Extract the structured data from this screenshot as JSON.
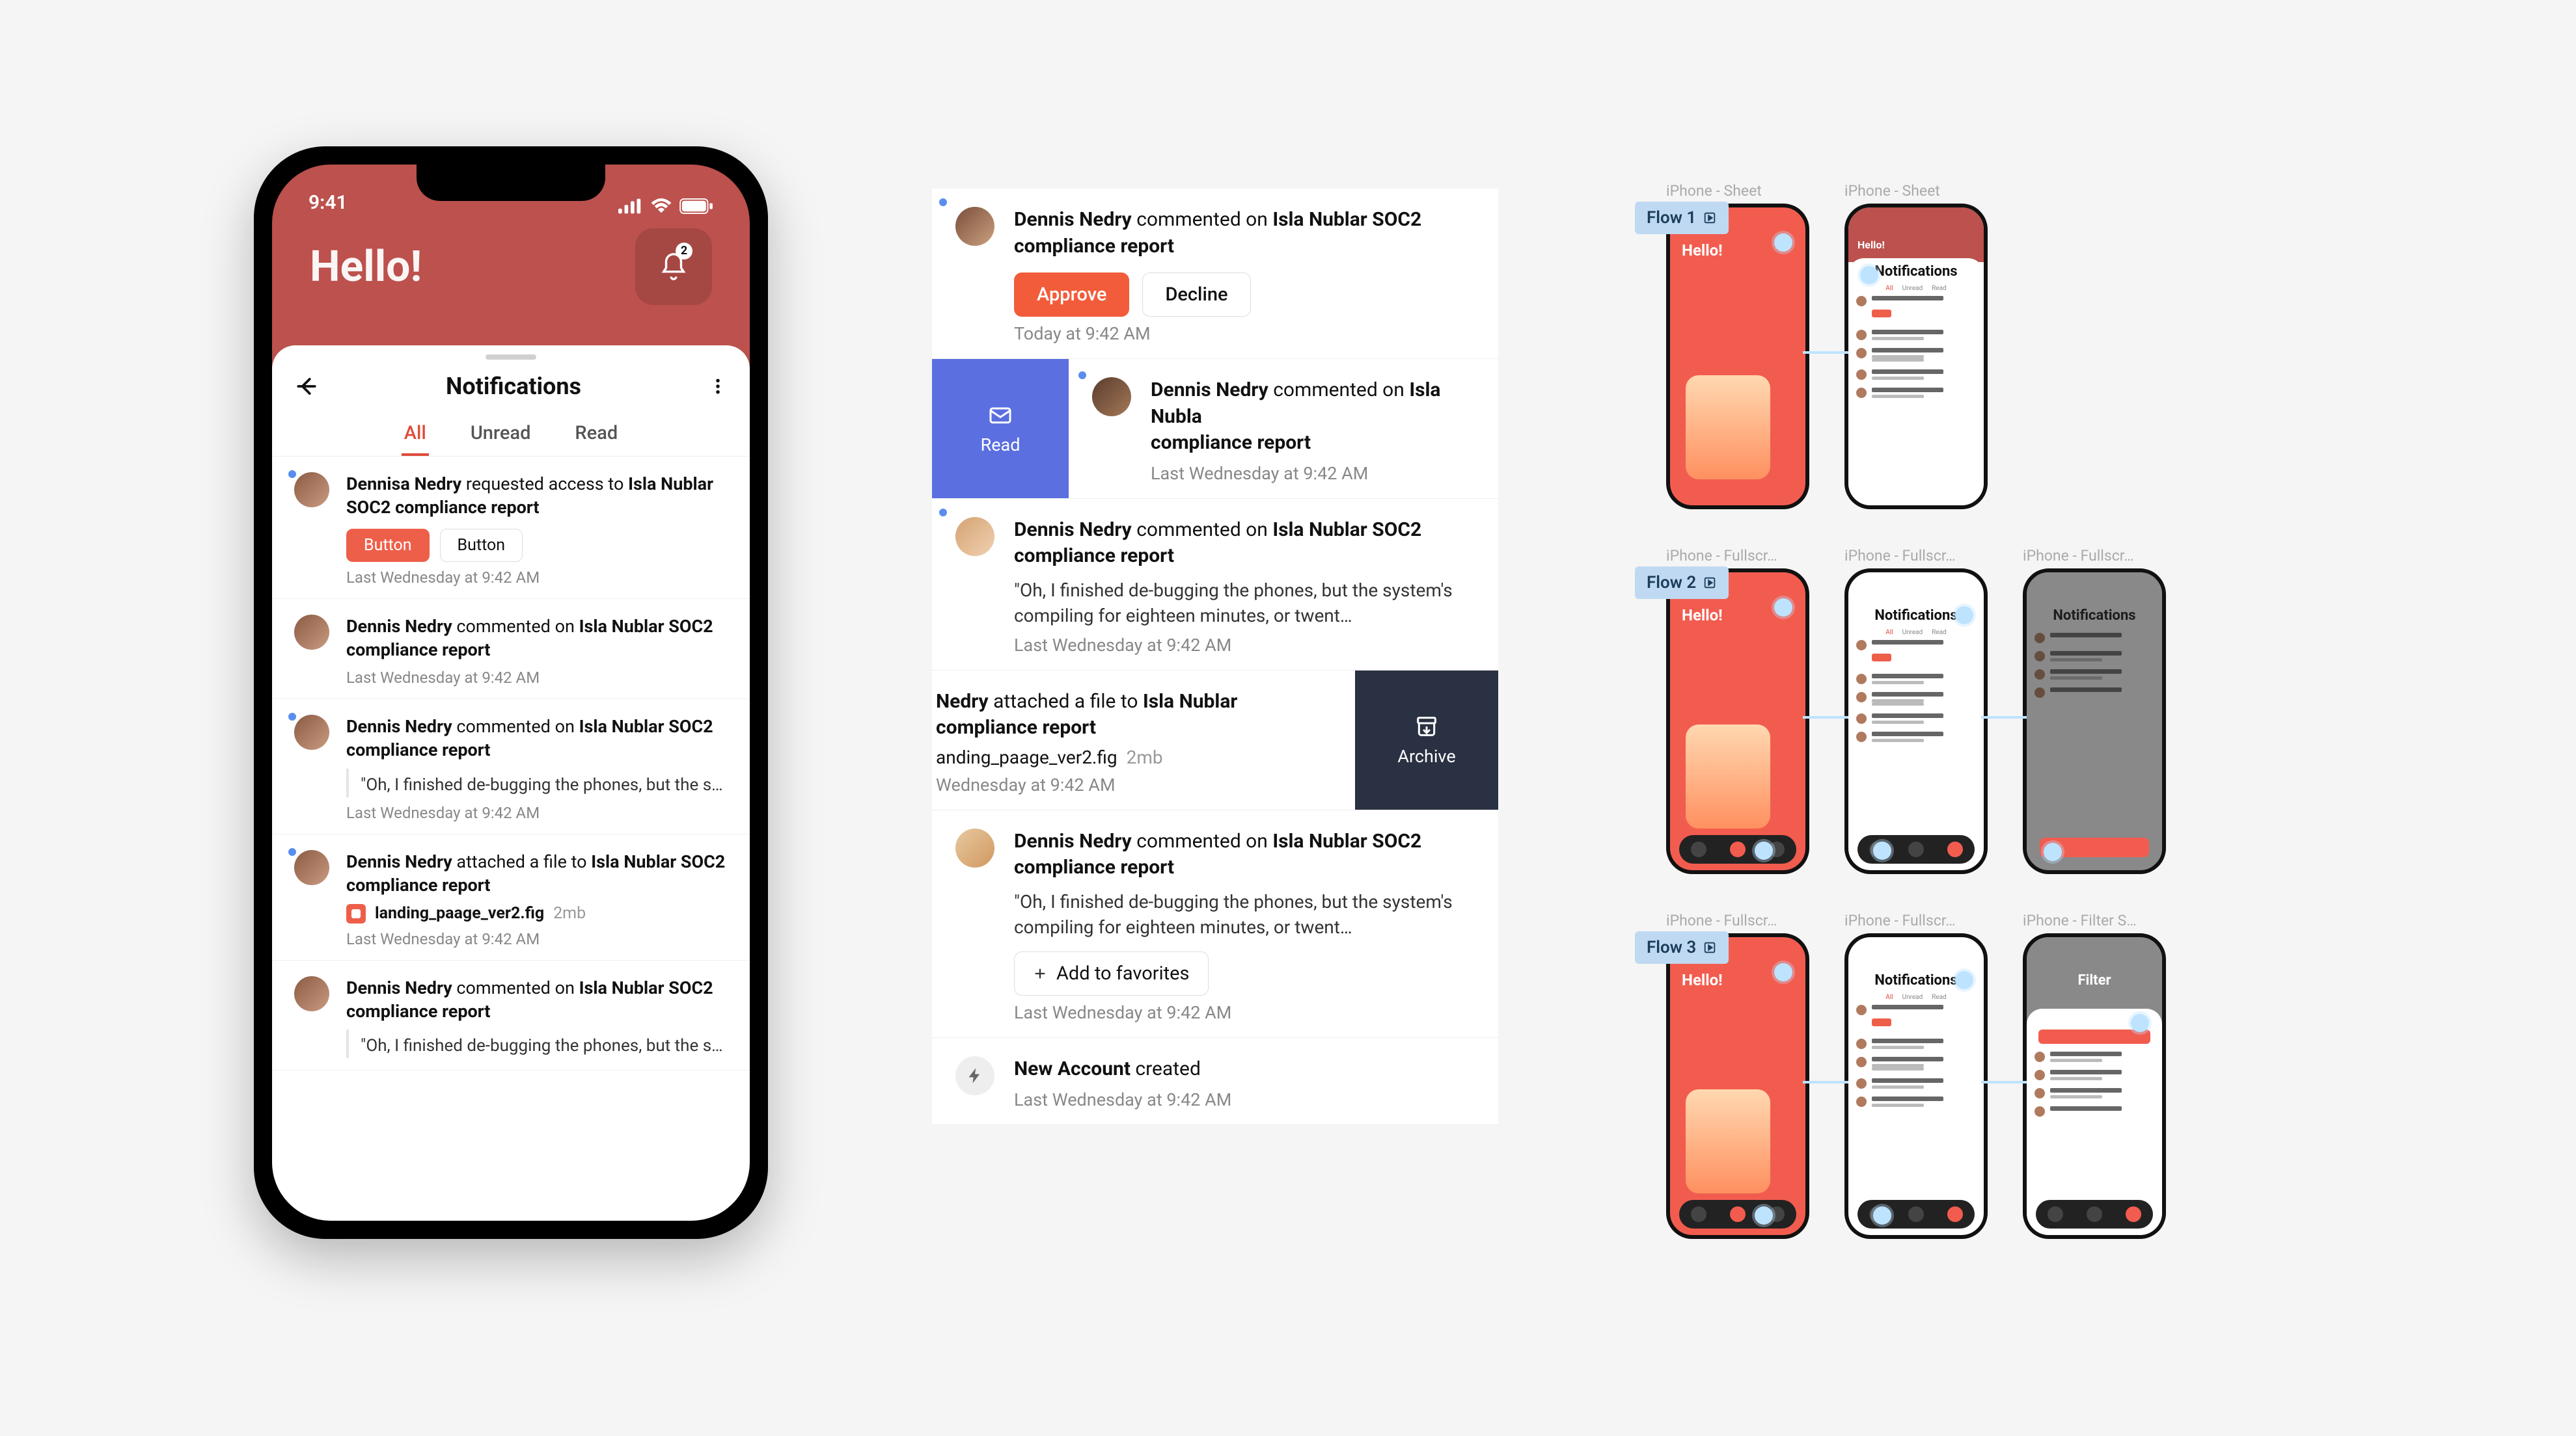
{
  "status_time": "9:41",
  "greeting": "Hello!",
  "bell_count": "2",
  "sheet_title": "Notifications",
  "tabs": {
    "all": "All",
    "unread": "Unread",
    "read": "Read"
  },
  "n1": {
    "actor": "Dennisa Nedry",
    "action": " requested access to ",
    "target": "Isla Nublar SOC2 compliance report",
    "b1": "Button",
    "b2": "Button",
    "ts": "Last Wednesday at 9:42 AM"
  },
  "n2": {
    "actor": "Dennis Nedry",
    "action": " commented on ",
    "target": "Isla Nublar SOC2 compliance report",
    "ts": "Last Wednesday at 9:42 AM"
  },
  "n3": {
    "actor": "Dennis Nedry",
    "action": " commented on ",
    "target": "Isla Nublar SOC2 compliance report",
    "quote": "\"Oh, I finished de-bugging the phones, but the system's compiling for eighteen minutes, or twent…",
    "ts": "Last Wednesday at 9:42 AM"
  },
  "n4": {
    "actor": "Dennis Nedry",
    "action": " attached a file to ",
    "target": "Isla Nublar SOC2 compliance report",
    "file": "landing_paage_ver2.fig",
    "size": "2mb",
    "ts": "Last Wednesday at 9:42 AM"
  },
  "n5": {
    "actor": "Dennis Nedry",
    "action": " commented on ",
    "target": "Isla Nublar SOC2 compliance report",
    "quote": "\"Oh, I finished de-bugging the phones, but the system's compiling for eighteen minutes, or twent…"
  },
  "mid": {
    "m1": {
      "actor": "Dennis Nedry",
      "action": " commented on ",
      "target": "Isla Nublar SOC2 compliance report",
      "approve": "Approve",
      "decline": "Decline",
      "ts": "Today at 9:42 AM"
    },
    "m2": {
      "swipe": "Read",
      "actor": "Dennis Nedry",
      "action": " commented on ",
      "target": "Isla Nubla",
      "target2": "compliance report",
      "ts": "Last Wednesday at 9:42 AM"
    },
    "m3": {
      "actor": "Dennis Nedry",
      "action": " commented on ",
      "target": "Isla Nublar SOC2 compliance report",
      "quote": "\"Oh, I finished de-bugging the phones, but the system's compiling for eighteen minutes, or twent…",
      "ts": "Last Wednesday at 9:42 AM"
    },
    "m4": {
      "swipe": "Archive",
      "actor_tail": " Nedry",
      "action": " attached a file to ",
      "target": "Isla Nublar",
      "target2": "compliance report",
      "file": "anding_paage_ver2.fig",
      "size": "2mb",
      "ts": "Wednesday at 9:42 AM"
    },
    "m5": {
      "actor": "Dennis Nedry",
      "action": " commented on ",
      "target": "Isla Nublar SOC2 compliance report",
      "quote": "\"Oh, I finished de-bugging the phones, but the system's compiling for eighteen minutes, or twent…",
      "addfav": "Add to favorites",
      "ts": "Last Wednesday at 9:42 AM"
    },
    "m6": {
      "title": "New Account",
      "action": " created",
      "ts": "Last Wednesday at 9:42 AM"
    }
  },
  "flows": {
    "f1": "Flow 1",
    "f2": "Flow 2",
    "f3": "Flow 3",
    "lab_sheet": "iPhone - Sheet",
    "lab_full": "iPhone - Fullscr…",
    "lab_filter": "iPhone - Filter S…",
    "notif": "Notifications",
    "filter": "Filter"
  }
}
